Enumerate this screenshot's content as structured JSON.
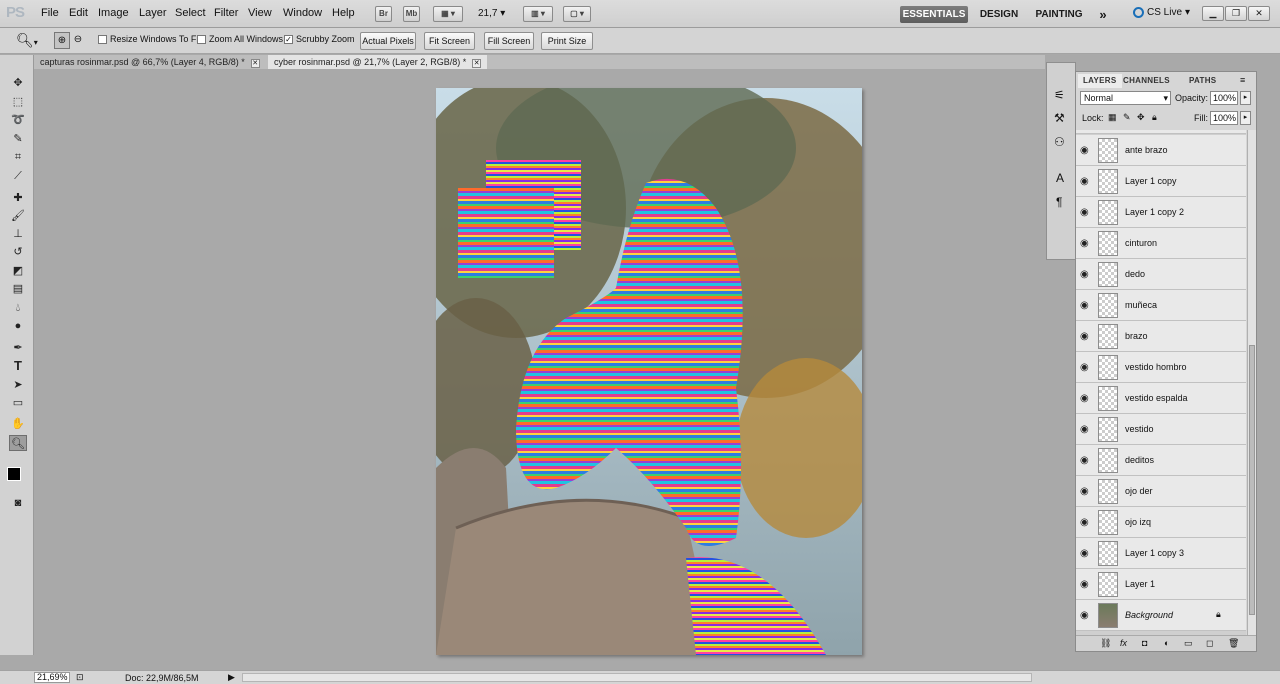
{
  "app": {
    "logo": "PS"
  },
  "menu": [
    "File",
    "Edit",
    "Image",
    "Layer",
    "Select",
    "Filter",
    "View",
    "Window",
    "Help"
  ],
  "appbar": {
    "br": "Br",
    "mb": "Mb",
    "zoom": "21,7"
  },
  "workspaces": [
    "ESSENTIALS",
    "DESIGN",
    "PAINTING"
  ],
  "workspace_more": "»",
  "cs_live": "CS Live",
  "options": {
    "resize_windows": {
      "label": "Resize Windows To Fit",
      "checked": false
    },
    "zoom_all": {
      "label": "Zoom All Windows",
      "checked": false
    },
    "scrubby": {
      "label": "Scrubby Zoom",
      "checked": true
    },
    "buttons": [
      "Actual Pixels",
      "Fit Screen",
      "Fill Screen",
      "Print Size"
    ]
  },
  "tabs": [
    {
      "label": "capturas rosinmar.psd @ 66,7% (Layer 4, RGB/8) *",
      "active": false
    },
    {
      "label": "cyber rosinmar.psd @ 21,7% (Layer 2, RGB/8) *",
      "active": true
    }
  ],
  "layers_panel": {
    "tabs": [
      "LAYERS",
      "CHANNELS",
      "PATHS"
    ],
    "blend_mode": "Normal",
    "opacity_label": "Opacity:",
    "opacity": "100%",
    "lock_label": "Lock:",
    "fill_label": "Fill:",
    "fill": "100%",
    "layers": [
      {
        "name": "ante brazo"
      },
      {
        "name": "Layer 1 copy"
      },
      {
        "name": "Layer 1 copy 2"
      },
      {
        "name": "cinturon"
      },
      {
        "name": "dedo"
      },
      {
        "name": "muñeca"
      },
      {
        "name": "brazo"
      },
      {
        "name": "vestido hombro"
      },
      {
        "name": "vestido espalda"
      },
      {
        "name": "vestido"
      },
      {
        "name": "deditos"
      },
      {
        "name": "ojo der"
      },
      {
        "name": "ojo izq"
      },
      {
        "name": "Layer 1 copy 3"
      },
      {
        "name": "Layer 1"
      },
      {
        "name": "Background",
        "locked": true
      }
    ]
  },
  "status": {
    "zoom": "21,69%",
    "doc": "Doc: 22,9M/86,5M"
  }
}
